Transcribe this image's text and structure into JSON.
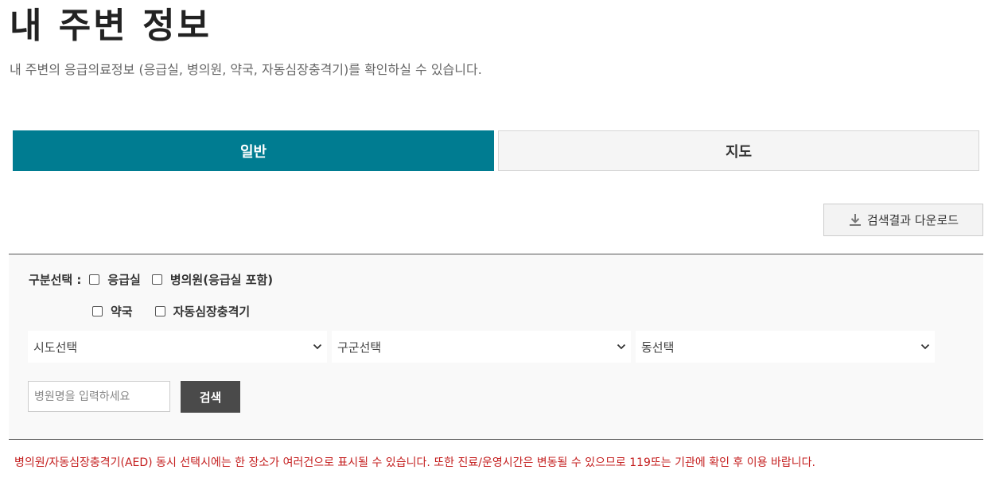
{
  "header": {
    "title": "내 주변 정보",
    "description": "내 주변의 응급의료정보 (응급실, 병의원, 약국, 자동심장충격기)를 확인하실 수 있습니다."
  },
  "tabs": [
    {
      "label": "일반",
      "active": true
    },
    {
      "label": "지도",
      "active": false
    }
  ],
  "toolbar": {
    "download_label": "검색결과 다운로드",
    "download_icon": "download-icon"
  },
  "filters": {
    "category_label": "구분선택 :",
    "categories": [
      {
        "label": "응급실",
        "checked": false
      },
      {
        "label": "병의원(응급실 포함)",
        "checked": false
      },
      {
        "label": "약국",
        "checked": false
      },
      {
        "label": "자동심장충격기",
        "checked": false
      }
    ],
    "selects": {
      "sido": "시도선택",
      "gugun": "구군선택",
      "dong": "동선택"
    },
    "search": {
      "placeholder": "병원명을 입력하세요",
      "value": "",
      "button_label": "검색"
    }
  },
  "notice": "병의원/자동심장충격기(AED) 동시 선택시에는 한 장소가 여러건으로 표시될 수 있습니다. 또한 진료/운영시간은 변동될 수 있으므로 119또는 기관에 확인 후 이용 바랍니다.",
  "colors": {
    "accent": "#007c91",
    "notice": "#c41e1e",
    "button_dark": "#4a4a4a"
  }
}
